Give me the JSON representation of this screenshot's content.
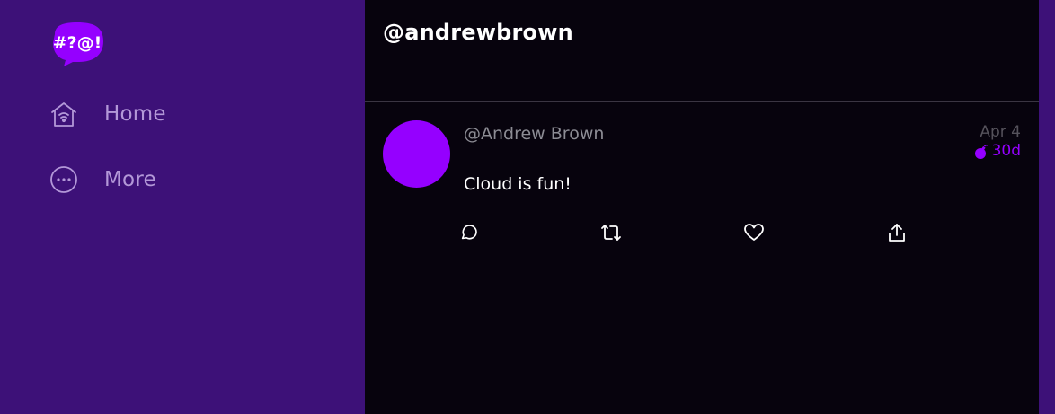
{
  "app": {
    "logo_text": "#?@!",
    "colors": {
      "sidebar_bg": "#3d1178",
      "main_bg": "#07030d",
      "accent": "#9500ff",
      "nav_text": "#b398d8"
    }
  },
  "sidebar": {
    "items": [
      {
        "label": "Home",
        "icon": "home-icon"
      },
      {
        "label": "More",
        "icon": "more-icon"
      }
    ]
  },
  "header": {
    "title": "@andrewbrown"
  },
  "feed": {
    "posts": [
      {
        "handle": "@Andrew Brown",
        "date": "Apr 4",
        "expires": "30d",
        "message": "Cloud is fun!",
        "actions": [
          "reply-icon",
          "repost-icon",
          "like-icon",
          "share-icon"
        ]
      }
    ]
  }
}
